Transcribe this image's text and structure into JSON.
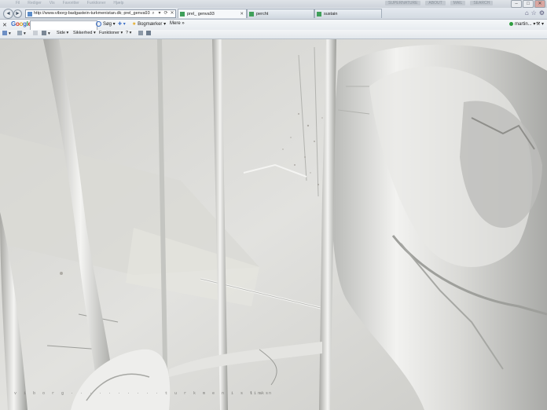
{
  "window": {
    "faded_menu": [
      "Fil",
      "Rediger",
      "Vis",
      "Favoritter",
      "Funktioner",
      "Hjælp"
    ],
    "faded_right": [
      "SUPERNATURE",
      "ABOUT",
      "MAIL",
      "SEARCH"
    ],
    "controls": {
      "minimize": "–",
      "maximize": "□",
      "close": "✕"
    }
  },
  "navbar": {
    "back": "◄",
    "forward": "►",
    "url": "http://www.viborg-badgastein-turkmenistan.dk; prel_genva93",
    "address_tools": [
      "⌕",
      "▾",
      "⟳",
      "✕"
    ],
    "tabs": [
      {
        "label": "prel_ genva93",
        "active": true,
        "close": "✕"
      },
      {
        "label": "percht",
        "active": false
      },
      {
        "label": "sustain",
        "active": false
      }
    ],
    "right_icons": [
      "⌂",
      "☆",
      "⚙"
    ]
  },
  "toolbar": {
    "google": "Google",
    "search_placeholder": "",
    "search_button": "Søg ▾",
    "bookmarks": "Bogmærker ▾",
    "more": "Mere »",
    "user": "martin... ▾",
    "wrench": "⚒ ▾"
  },
  "command_bar": {
    "side": "Side ▾",
    "sikkerhed": "Sikkerhed ▾",
    "funktioner": "Funktioner ▾",
    "help": "? ▾"
  },
  "page": {
    "caption": "v i b o r g  ·  ·  ·  ·  ·  ·  ·  ·  ·  ·  t u r k m e n i s t a n",
    "link": "links"
  },
  "colors": {
    "google_blue": "#3b6ec6",
    "google_red": "#d2392b",
    "google_yellow": "#e5a81b",
    "google_green": "#2e9d3f",
    "status_online": "#2e9d3f"
  }
}
